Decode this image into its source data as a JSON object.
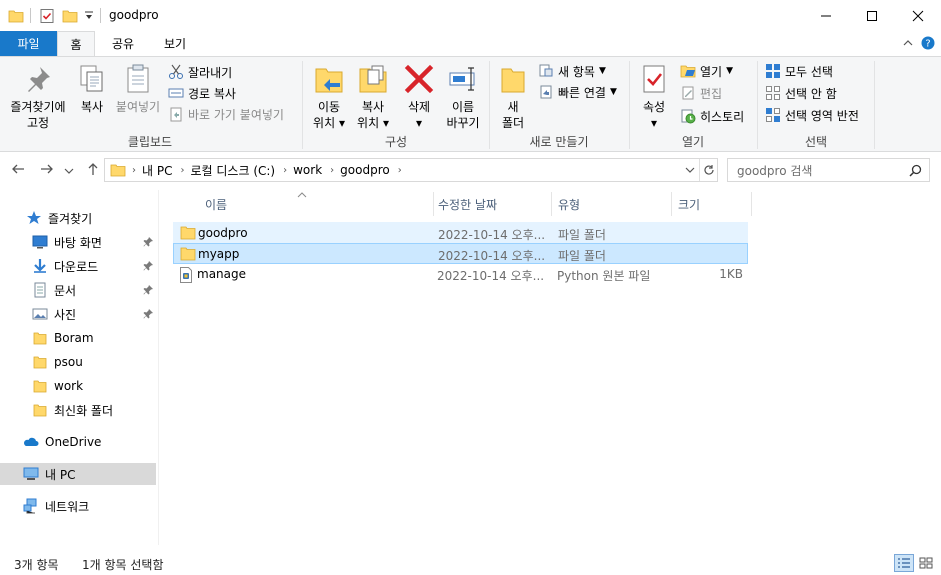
{
  "window": {
    "title": "goodpro",
    "buttons": {
      "minimize": "—",
      "maximize": "□",
      "close": "✕"
    }
  },
  "tabs": [
    {
      "label": "파일",
      "active": false,
      "color": "#1979ca"
    },
    {
      "label": "홈",
      "active": true
    },
    {
      "label": "공유",
      "active": false
    },
    {
      "label": "보기",
      "active": false
    }
  ],
  "ribbon": {
    "clipboard": {
      "label": "클립보드",
      "pin_line1": "즐겨찾기에",
      "pin_line2": "고정",
      "copy": "복사",
      "paste": "붙여넣기",
      "cut": "잘라내기",
      "copy_path": "경로 복사",
      "paste_shortcut": "바로 가기 붙여넣기"
    },
    "organize": {
      "label": "구성",
      "move_line1": "이동",
      "move_line2": "위치",
      "copyto_line1": "복사",
      "copyto_line2": "위치",
      "delete": "삭제",
      "rename_line1": "이름",
      "rename_line2": "바꾸기"
    },
    "new": {
      "label": "새로 만들기",
      "new_folder_line1": "새",
      "new_folder_line2": "폴더",
      "new_item": "새 항목",
      "easy_access": "빠른 연결"
    },
    "open": {
      "label": "열기",
      "properties": "속성",
      "open": "열기",
      "edit": "편집",
      "history": "히스토리"
    },
    "select": {
      "label": "선택",
      "select_all": "모두 선택",
      "select_none": "선택 안 함",
      "invert": "선택 영역 반전"
    }
  },
  "address": {
    "breadcrumbs": [
      "내 PC",
      "로컬 디스크 (C:)",
      "work",
      "goodpro"
    ],
    "search_placeholder": "goodpro 검색"
  },
  "nav": {
    "quick_access": "즐겨찾기",
    "pinned": [
      {
        "label": "바탕 화면",
        "icon": "desktop-icon"
      },
      {
        "label": "다운로드",
        "icon": "download-icon"
      },
      {
        "label": "문서",
        "icon": "document-icon"
      },
      {
        "label": "사진",
        "icon": "picture-icon"
      }
    ],
    "folders": [
      {
        "label": "Boram"
      },
      {
        "label": "psou"
      },
      {
        "label": "work"
      },
      {
        "label": "최신화 폴더"
      }
    ],
    "onedrive": "OneDrive",
    "this_pc": "내 PC",
    "network": "네트워크"
  },
  "list": {
    "columns": {
      "name": "이름",
      "date": "수정한 날짜",
      "type": "유형",
      "size": "크기"
    },
    "rows": [
      {
        "name": "goodpro",
        "date": "2022-10-14 오후...",
        "type": "파일 폴더",
        "size": "",
        "icon": "folder-icon",
        "state": "hover"
      },
      {
        "name": "myapp",
        "date": "2022-10-14 오후...",
        "type": "파일 폴더",
        "size": "",
        "icon": "folder-icon",
        "state": "selected"
      },
      {
        "name": "manage",
        "date": "2022-10-14 오후...",
        "type": "Python 원본 파일",
        "size": "1KB",
        "icon": "python-file-icon",
        "state": "normal"
      }
    ]
  },
  "status": {
    "count": "3개 항목",
    "selected": "1개 항목 선택함"
  },
  "colors": {
    "accent": "#1979ca",
    "folder": "#ffd86b",
    "selection": "#cce8ff",
    "hover": "#e5f3ff",
    "delete_red": "#d8242a"
  }
}
